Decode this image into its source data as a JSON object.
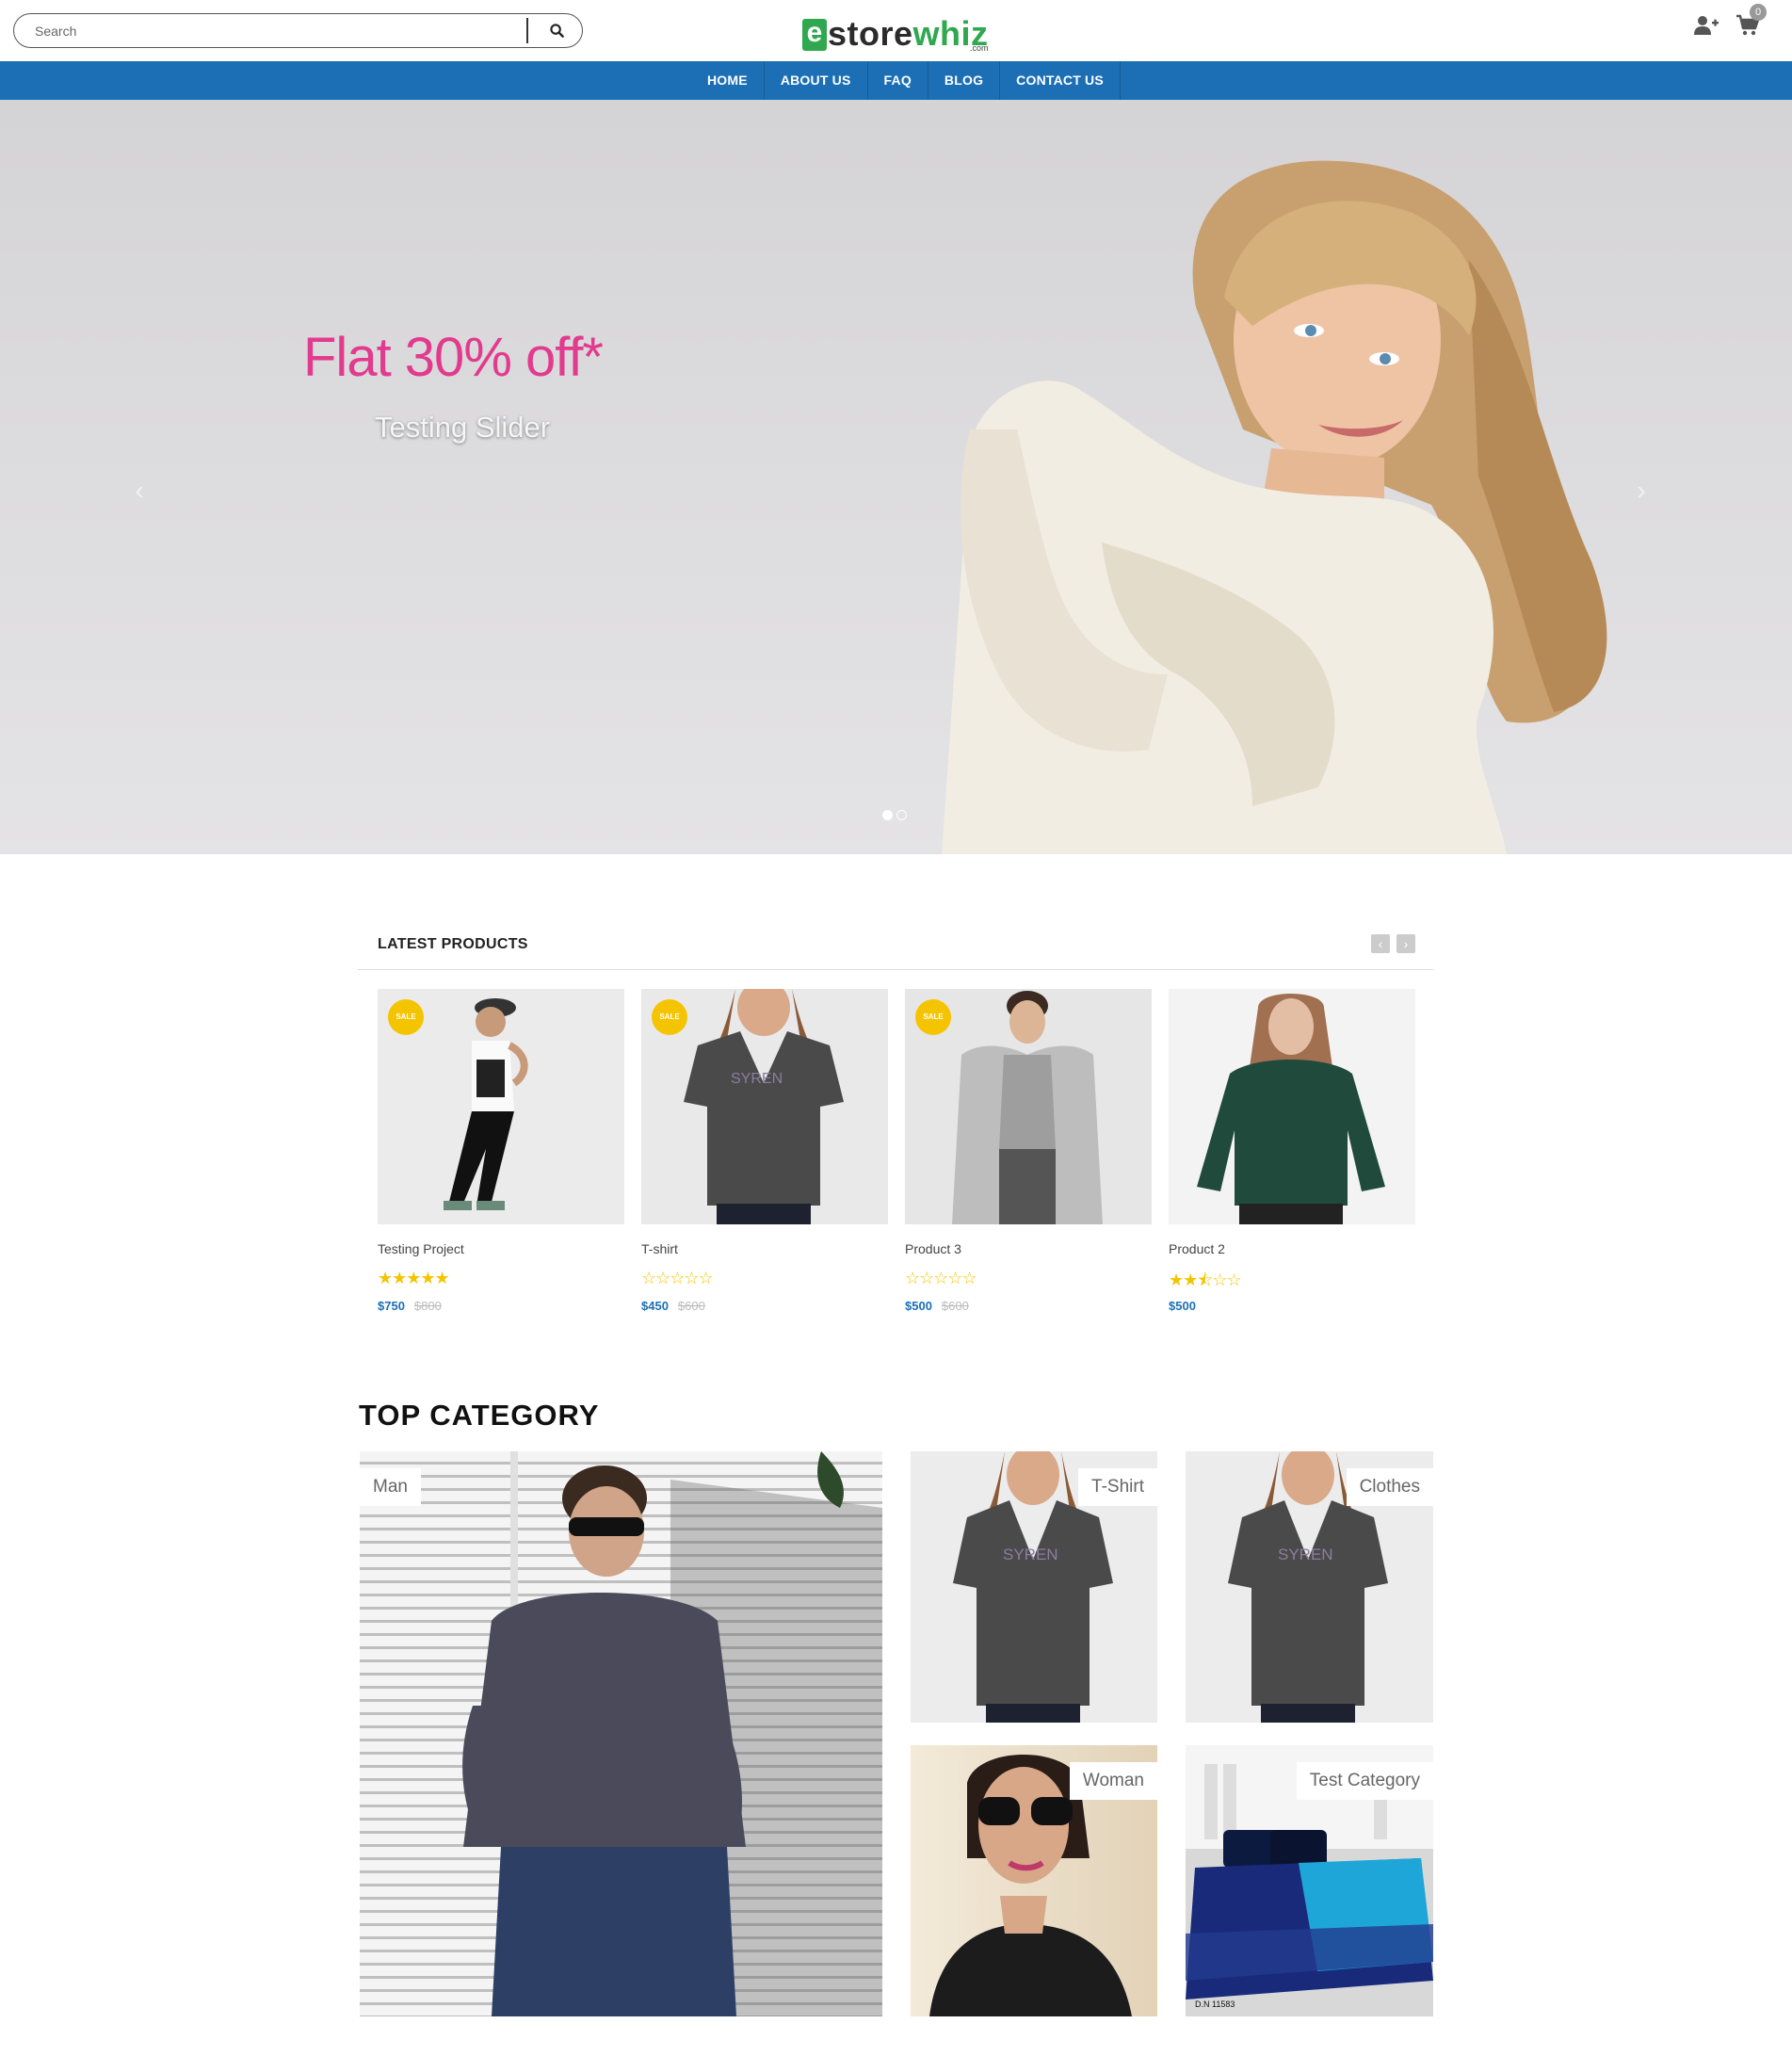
{
  "header": {
    "search_placeholder": "Search",
    "logo": {
      "e": "e",
      "store": "store",
      "whiz": "whiz",
      "com": ".com"
    },
    "cart_count": "0"
  },
  "nav": {
    "items": [
      "HOME",
      "ABOUT US",
      "FAQ",
      "BLOG",
      "CONTACT US"
    ]
  },
  "hero": {
    "title": "Flat 30% off*",
    "subtitle": "Testing Slider",
    "prev": "‹",
    "next": "›"
  },
  "latest": {
    "title": "LATEST PRODUCTS",
    "prev": "‹",
    "next": "›",
    "products": [
      {
        "name": "Testing Project",
        "sale": "SALE",
        "price": "$750",
        "old_price": "$800",
        "rating": 5
      },
      {
        "name": "T-shirt",
        "sale": "SALE",
        "price": "$450",
        "old_price": "$600",
        "rating": 0
      },
      {
        "name": "Product 3",
        "sale": "SALE",
        "price": "$500",
        "old_price": "$600",
        "rating": 0
      },
      {
        "name": "Product 2",
        "sale": "",
        "price": "$500",
        "old_price": "",
        "rating": 2.5
      }
    ]
  },
  "categories": {
    "title": "TOP CATEGORY",
    "items": [
      "Man",
      "T-Shirt",
      "Clothes",
      "Woman",
      "Test Category"
    ]
  },
  "colors": {
    "accent": "#1c6fb5",
    "brand_green": "#2fa84f",
    "hero_title": "#e23a8e",
    "sale_badge": "#f5c400"
  }
}
